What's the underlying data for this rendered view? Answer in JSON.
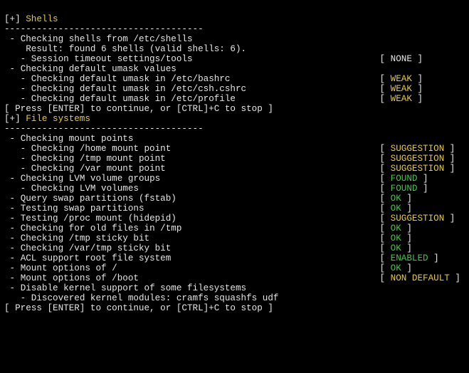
{
  "sections": [
    {
      "title": "Shells",
      "items": [
        {
          "indent": 1,
          "text": "Checking shells from /etc/shells",
          "status": null,
          "statusColor": null
        },
        {
          "indent": 1,
          "bullet": " ",
          "text": "   Result: found 6 shells (valid shells: 6).",
          "status": null,
          "statusColor": null
        },
        {
          "indent": 2,
          "text": "Session timeout settings/tools",
          "status": "NONE",
          "statusColor": "white"
        },
        {
          "indent": 1,
          "text": "Checking default umask values",
          "status": null,
          "statusColor": null
        },
        {
          "indent": 2,
          "text": "Checking default umask in /etc/bashrc",
          "status": "WEAK",
          "statusColor": "yellow"
        },
        {
          "indent": 2,
          "text": "Checking default umask in /etc/csh.cshrc",
          "status": "WEAK",
          "statusColor": "yellow"
        },
        {
          "indent": 2,
          "text": "Checking default umask in /etc/profile",
          "status": "WEAK",
          "statusColor": "yellow"
        }
      ],
      "prompt": "[ Press [ENTER] to continue, or [CTRL]+C to stop ]"
    },
    {
      "title": "File systems",
      "items": [
        {
          "indent": 1,
          "text": "Checking mount points",
          "status": null,
          "statusColor": null
        },
        {
          "indent": 2,
          "text": "Checking /home mount point",
          "status": "SUGGESTION",
          "statusColor": "yellow"
        },
        {
          "indent": 2,
          "text": "Checking /tmp mount point",
          "status": "SUGGESTION",
          "statusColor": "yellow"
        },
        {
          "indent": 2,
          "text": "Checking /var mount point",
          "status": "SUGGESTION",
          "statusColor": "yellow"
        },
        {
          "indent": 1,
          "text": "Checking LVM volume groups",
          "status": "FOUND",
          "statusColor": "green"
        },
        {
          "indent": 2,
          "text": "Checking LVM volumes",
          "status": "FOUND",
          "statusColor": "green"
        },
        {
          "indent": 1,
          "text": "Query swap partitions (fstab)",
          "status": "OK",
          "statusColor": "green"
        },
        {
          "indent": 1,
          "text": "Testing swap partitions",
          "status": "OK",
          "statusColor": "green"
        },
        {
          "indent": 1,
          "text": "Testing /proc mount (hidepid)",
          "status": "SUGGESTION",
          "statusColor": "yellow"
        },
        {
          "indent": 1,
          "text": "Checking for old files in /tmp",
          "status": "OK",
          "statusColor": "green"
        },
        {
          "indent": 1,
          "text": "Checking /tmp sticky bit",
          "status": "OK",
          "statusColor": "green"
        },
        {
          "indent": 1,
          "text": "Checking /var/tmp sticky bit",
          "status": "OK",
          "statusColor": "green"
        },
        {
          "indent": 1,
          "text": "ACL support root file system",
          "status": "ENABLED",
          "statusColor": "green"
        },
        {
          "indent": 1,
          "text": "Mount options of /",
          "status": "OK",
          "statusColor": "green"
        },
        {
          "indent": 1,
          "text": "Mount options of /boot",
          "status": "NON DEFAULT",
          "statusColor": "yellow"
        },
        {
          "indent": 1,
          "text": "Disable kernel support of some filesystems",
          "status": null,
          "statusColor": null
        },
        {
          "indent": 2,
          "text": "Discovered kernel modules: cramfs squashfs udf",
          "status": null,
          "statusColor": null
        }
      ],
      "prompt": "[ Press [ENTER] to continue, or [CTRL]+C to stop ]"
    }
  ],
  "glyphs": {
    "sectionOpen": "[+]",
    "divider": "-------------------------------------",
    "bullet1": " - ",
    "bullet2": "   - "
  }
}
